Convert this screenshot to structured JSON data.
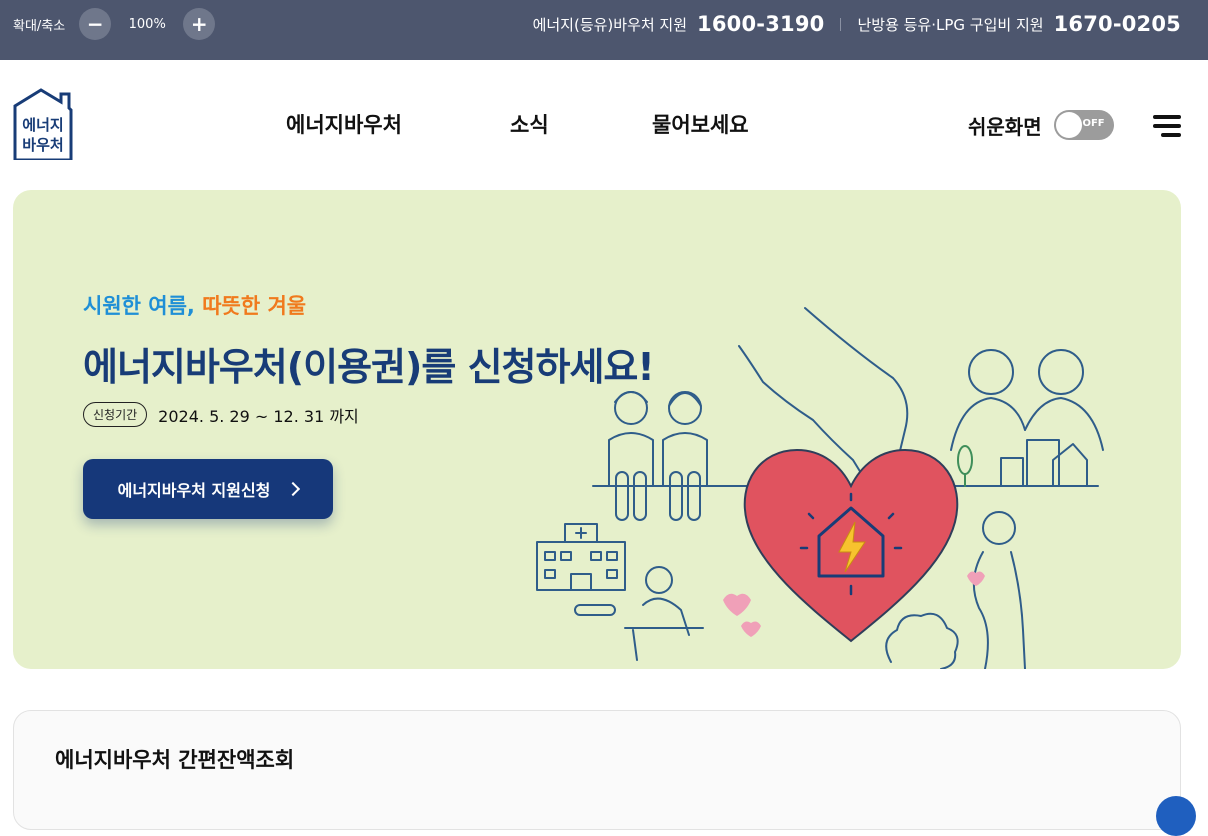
{
  "topbar": {
    "zoom_label": "확대/축소",
    "zoom_out_symbol": "−",
    "zoom_value": "100%",
    "zoom_in_symbol": "+",
    "hotline1_label": "에너지(등유)바우처 지원",
    "hotline1_number": "1600-3190",
    "hotline2_label": "난방용 등유·LPG 구입비 지원",
    "hotline2_number": "1670-0205"
  },
  "header": {
    "logo_line1": "에너지",
    "logo_line2": "바우처",
    "nav": [
      "에너지바우처",
      "소식",
      "물어보세요"
    ],
    "easy_mode_label": "쉬운화면",
    "toggle_state": "OFF",
    "menu_icon": "hamburger-icon"
  },
  "hero": {
    "sub_part1": "시원한 여름,",
    "sub_part2": "따뜻한 겨울",
    "title": "에너지바우처(이용권)를 신청하세요!",
    "period_badge": "신청기간",
    "period_text": "2024. 5. 29 ~ 12. 31 까지",
    "apply_button": "에너지바우처 지원신청"
  },
  "balance_card": {
    "title": "에너지바우처 간편잔액조회"
  },
  "colors": {
    "topbar_bg": "#4d566e",
    "hero_bg": "#e6f0cb",
    "brand_navy": "#183c77",
    "button_navy": "#16387a",
    "accent_blue": "#1f8fd6",
    "accent_orange": "#f07a1d",
    "heart_red": "#e0535f"
  }
}
